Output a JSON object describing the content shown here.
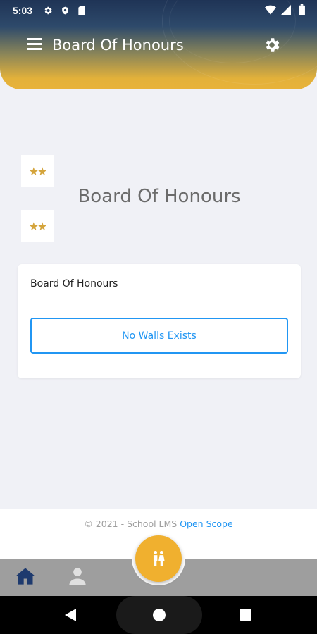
{
  "status_bar": {
    "time": "5:03",
    "icons_left": [
      "settings-icon",
      "shield-icon",
      "sd-card-icon"
    ],
    "icons_right": [
      "wifi-icon",
      "signal-icon",
      "battery-icon"
    ]
  },
  "app_bar": {
    "title": "Board Of Honours",
    "menu_icon": "hamburger-menu-icon",
    "settings_icon": "gear-icon"
  },
  "hero": {
    "title": "Board Of Honours",
    "badge_stars": "★★"
  },
  "card": {
    "header": "Board Of Honours",
    "empty_message": "No Walls Exists"
  },
  "footer": {
    "copyright": "© 2021 - School LMS",
    "link_text": "Open Scope"
  },
  "bottom_nav": {
    "items": [
      "home-icon",
      "profile-icon"
    ],
    "fab_icon": "parents-icon"
  },
  "colors": {
    "accent": "#f0b02f",
    "header_dark": "#1f3456",
    "link": "#2196f3",
    "nav_bg": "#9e9e9e",
    "home_active": "#1e3a6e"
  }
}
